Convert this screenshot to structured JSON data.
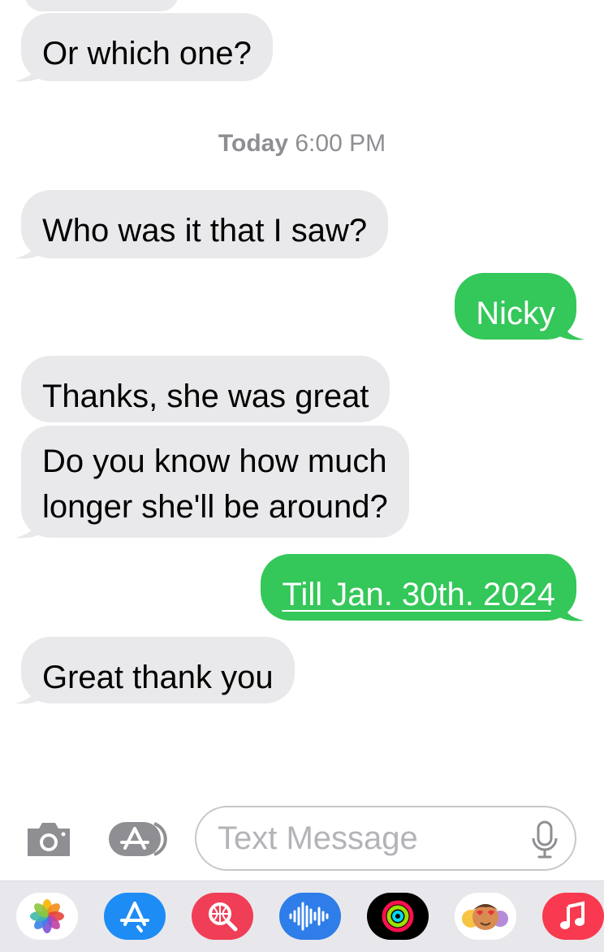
{
  "conversation": {
    "timestamp_day": "Today",
    "timestamp_time": "6:00 PM",
    "messages": [
      {
        "direction": "received",
        "text": "Or which one?"
      },
      {
        "direction": "received",
        "text": "Who was it that I saw?"
      },
      {
        "direction": "sent",
        "text": "Nicky"
      },
      {
        "direction": "received",
        "text": "Thanks, she was great"
      },
      {
        "direction": "received",
        "line1": "Do you know how much",
        "line2": "longer she'll be around?"
      },
      {
        "direction": "sent",
        "text": "Till Jan. 30th. 2024",
        "is_link": true
      },
      {
        "direction": "received",
        "text": "Great thank you"
      }
    ]
  },
  "input_bar": {
    "placeholder": "Text Message",
    "icons": [
      "camera-icon",
      "app-store-icon",
      "microphone-icon"
    ]
  },
  "app_drawer": {
    "apps": [
      "photos",
      "app-store",
      "search-images",
      "audio-message",
      "activity",
      "memoji",
      "music"
    ]
  },
  "colors": {
    "sent_bubble": "#34c759",
    "received_bubble": "#e9e9eb",
    "timestamp": "#8e8e93"
  }
}
